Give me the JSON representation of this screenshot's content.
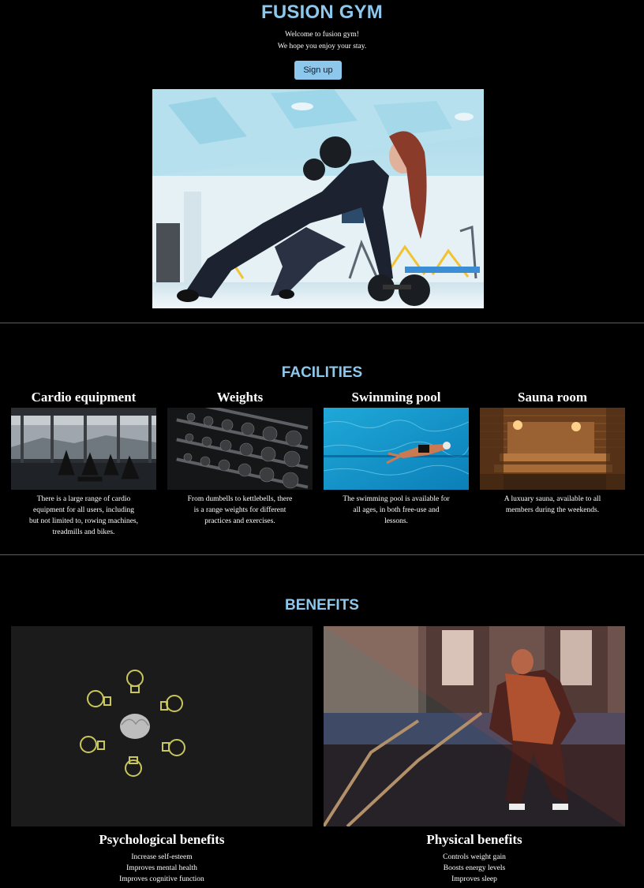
{
  "header": {
    "brand": "FUSION GYM",
    "welcome_line1": "Welcome to fusion gym!",
    "welcome_line2": "We hope you enjoy your stay.",
    "signup_label": "Sign up"
  },
  "facilities": {
    "title": "FACILITIES",
    "items": [
      {
        "name": "Cardio equipment",
        "description": "There is a large range of cardio equipment for all users, including but not limited to, rowing machines, treadmills and bikes."
      },
      {
        "name": "Weights",
        "description": "From dumbells to kettlebells, there is a range weights for different practices and exercises."
      },
      {
        "name": "Swimming pool",
        "description": "The swimming pool is available for all ages, in both free-use and lessons."
      },
      {
        "name": "Sauna room",
        "description": "A luxuary sauna, available to all members during the weekends."
      }
    ]
  },
  "benefits": {
    "title": "BENEFITS",
    "items": [
      {
        "name": "Psychological benefits",
        "points": [
          "Increase self-esteem",
          "Improves mental health",
          "Improves cognitive function"
        ]
      },
      {
        "name": "Physical benefits",
        "points": [
          "Controls weight gain",
          "Boosts energy levels",
          "Improves sleep"
        ]
      }
    ]
  },
  "colors": {
    "accent": "#8ec7ec",
    "background": "#000000",
    "divider": "#5a5f66"
  }
}
